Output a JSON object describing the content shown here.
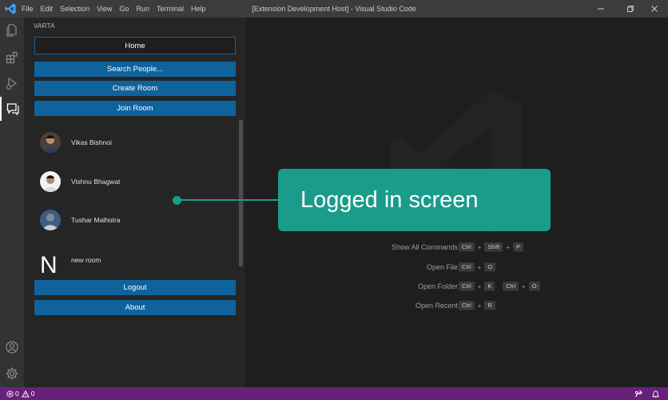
{
  "titlebar": {
    "menu": [
      "File",
      "Edit",
      "Selection",
      "View",
      "Go",
      "Run",
      "Terminal",
      "Help"
    ],
    "title": "[Extension Development Host] - Visual Studio Code"
  },
  "sidebar": {
    "title": "VARTA",
    "buttons": {
      "home": "Home",
      "search": "Search People...",
      "create_room": "Create Room",
      "join_room": "Join Room",
      "logout": "Logout",
      "about": "About"
    },
    "people": [
      {
        "name": "Vikas Bishnoi"
      },
      {
        "name": "Vishnu Bhagwat"
      },
      {
        "name": "Tushar Malhotra"
      }
    ],
    "room": {
      "initial": "N",
      "name": "new room"
    }
  },
  "editor": {
    "shortcuts": [
      {
        "label": "Show All Commands",
        "keys": [
          "Ctrl",
          "Shift",
          "P"
        ]
      },
      {
        "label": "Open File",
        "keys": [
          "Ctrl",
          "O"
        ]
      },
      {
        "label": "Open Folder",
        "keys": [
          "Ctrl",
          "K"
        ],
        "keys2": [
          "Ctrl",
          "O"
        ]
      },
      {
        "label": "Open Recent",
        "keys": [
          "Ctrl",
          "R"
        ]
      }
    ]
  },
  "annotation": {
    "text": "Logged in screen"
  },
  "statusbar": {
    "errors": "0",
    "warnings": "0"
  },
  "colors": {
    "accent": "#0e639c",
    "statusbar": "#68217a",
    "callout": "#1a9c8a"
  }
}
